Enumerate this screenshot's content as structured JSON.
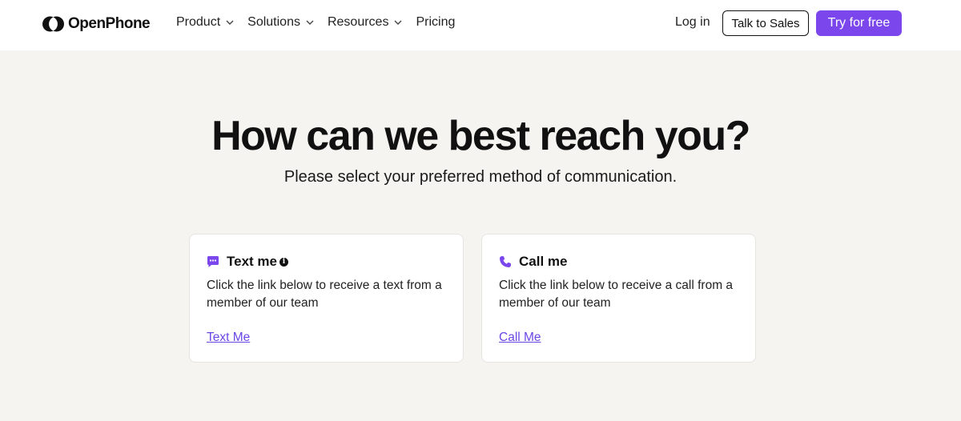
{
  "brand": {
    "name": "OpenPhone",
    "logo_icon": "openphone-logo-icon"
  },
  "nav": {
    "items": [
      {
        "label": "Product",
        "has_dropdown": true
      },
      {
        "label": "Solutions",
        "has_dropdown": true
      },
      {
        "label": "Resources",
        "has_dropdown": true
      },
      {
        "label": "Pricing",
        "has_dropdown": false
      }
    ],
    "login_label": "Log in",
    "sales_label": "Talk to Sales",
    "try_label": "Try for free"
  },
  "hero": {
    "title": "How can we best reach you?",
    "subtitle": "Please select your preferred method of communication."
  },
  "cards": [
    {
      "icon": "chat-bubble-icon",
      "title": "Text me",
      "info_icon": "info-icon",
      "description": "Click the link below to receive a text from a member of our team",
      "link": "Text Me"
    },
    {
      "icon": "phone-icon",
      "title": "Call me",
      "description": "Click the link below to receive a call from a member of our team",
      "link": "Call Me"
    }
  ],
  "colors": {
    "accent": "#7b47ed",
    "link": "#6b46e6",
    "page_background": "#f5f4f0",
    "header_background": "#ffffff"
  }
}
